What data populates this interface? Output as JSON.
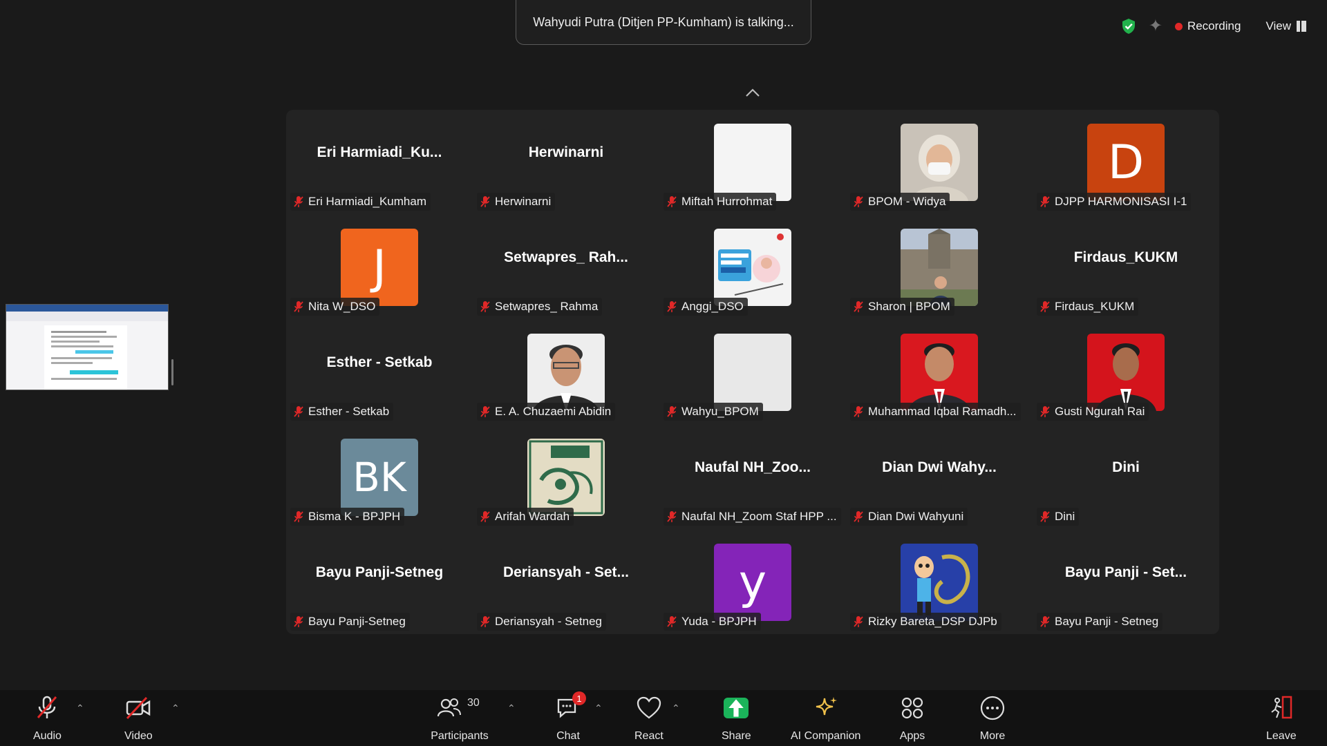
{
  "talking_banner": "Wahyudi Putra (Ditjen PP-Kumham) is talking...",
  "top_right": {
    "recording": "Recording",
    "view": "View"
  },
  "colors": {
    "accent_green": "#1bb35a",
    "danger": "#e02828"
  },
  "participants": [
    {
      "name": "Eri Harmiadi_Kumham",
      "display": "Eri  Harmiadi_Ku..."
    },
    {
      "name": "Herwinarni",
      "display": "Herwinarni"
    },
    {
      "name": "Miftah Hurrohmat",
      "display": ""
    },
    {
      "name": "BPOM - Widya",
      "display": ""
    },
    {
      "name": "DJPP HARMONISASI I-1",
      "display": "",
      "letter": "D"
    },
    {
      "name": "Nita W_DSO",
      "display": "",
      "letter": "J"
    },
    {
      "name": "Setwapres_ Rahma",
      "display": "Setwapres_ Rah..."
    },
    {
      "name": "Anggi_DSO",
      "display": ""
    },
    {
      "name": "Sharon | BPOM",
      "display": ""
    },
    {
      "name": "Firdaus_KUKM",
      "display": "Firdaus_KUKM"
    },
    {
      "name": "Esther - Setkab",
      "display": "Esther - Setkab"
    },
    {
      "name": "E. A. Chuzaemi Abidin",
      "display": ""
    },
    {
      "name": "Wahyu_BPOM",
      "display": ""
    },
    {
      "name": "Muhammad Iqbal Ramadh...",
      "display": ""
    },
    {
      "name": "Gusti Ngurah Rai",
      "display": ""
    },
    {
      "name": "Bisma K - BPJPH",
      "display": "",
      "letter": "BK"
    },
    {
      "name": "Arifah Wardah",
      "display": ""
    },
    {
      "name": "Naufal NH_Zoom Staf HPP ...",
      "display": "Naufal  NH_Zoo..."
    },
    {
      "name": "Dian Dwi Wahyuni",
      "display": "Dian  Dwi  Wahy..."
    },
    {
      "name": "Dini",
      "display": "Dini"
    },
    {
      "name": "Bayu Panji-Setneg",
      "display": "Bayu Panji-Setneg"
    },
    {
      "name": "Deriansyah - Setneg",
      "display": "Deriansyah - Set..."
    },
    {
      "name": "Yuda - BPJPH",
      "display": "",
      "letter": "y"
    },
    {
      "name": "Rizky Bareta_DSP DJPb",
      "display": ""
    },
    {
      "name": "Bayu Panji - Setneg",
      "display": "Bayu Panji - Set..."
    }
  ],
  "toolbar": {
    "audio": "Audio",
    "video": "Video",
    "participants": "Participants",
    "participants_count": "30",
    "chat": "Chat",
    "chat_badge": "1",
    "react": "React",
    "share": "Share",
    "ai_companion": "AI Companion",
    "apps": "Apps",
    "more": "More",
    "leave": "Leave"
  }
}
